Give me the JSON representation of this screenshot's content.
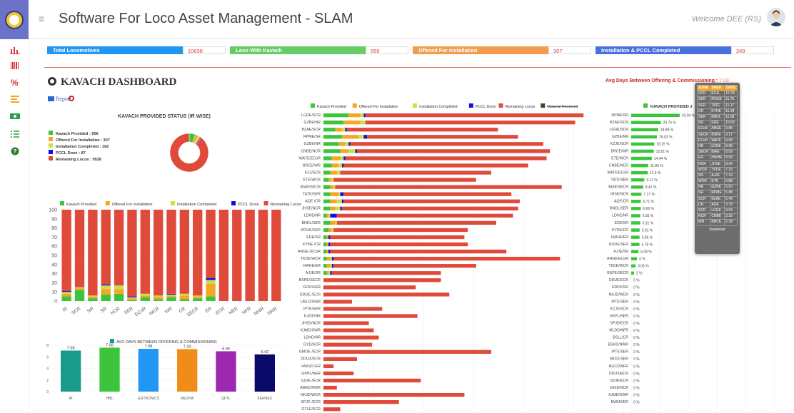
{
  "header": {
    "title": "Software For Loco Asset Management - SLAM",
    "welcome": "Welcome DEE (RS)"
  },
  "sidebar": {
    "icons": [
      "bar-chart-icon",
      "barcode-icon",
      "percent-icon",
      "list-icon",
      "money-icon",
      "list-check-icon",
      "help-icon"
    ]
  },
  "kpis": [
    {
      "label": "Total Locomotives",
      "value": "10638",
      "color": "#2196f3"
    },
    {
      "label": "Loco With Kavach",
      "value": "556",
      "color": "#66cc66"
    },
    {
      "label": "Offered For Installation",
      "value": "307",
      "color": "#f39c4f"
    },
    {
      "label": "Installation & PCCL Completed",
      "value": "249",
      "color": "#4a6fe0"
    }
  ],
  "dashboard": {
    "title": "KAVACH DASHBOARD",
    "report_label": "Report",
    "avg_days_heading": "Avg Days Between Offering & Commissioning : ",
    "avg_days_value": "7.08"
  },
  "colors": {
    "provided": "#3cc43c",
    "offered": "#f5a623",
    "installed": "#c8e04a",
    "pccl": "#1010e0",
    "remaining": "#e04a3a",
    "material": "#444422"
  },
  "status_pie": {
    "title": "KAVACH PROVIDED STATUS (IR WISE)",
    "legend": [
      "Kavach Provided : 556",
      "Offered For Installation : 307",
      "Installation Completed : 162",
      "PCCL Done : 87",
      "Remaining Locos : 9526"
    ],
    "values": [
      556,
      307,
      162,
      87,
      9526
    ]
  },
  "stacked_legend": [
    "Kavach Provided",
    "Offered For Installation",
    "Installation Completed",
    "PCCL Done",
    "Remaining Locos"
  ],
  "stacked": {
    "categories": [
      "IR",
      "SCR",
      "NR",
      "SR",
      "NCR",
      "SER",
      "ECoR",
      "WCR",
      "WR",
      "CR",
      "SECR",
      "ER",
      "ECR",
      "NER",
      "NFR",
      "NWR",
      "SWR"
    ],
    "provided": [
      5,
      12,
      3,
      7,
      8,
      1,
      4,
      2,
      4,
      2,
      3,
      5,
      0,
      0,
      0,
      0,
      0
    ],
    "offered": [
      3,
      2,
      2,
      6,
      5,
      2,
      2,
      3,
      2,
      4,
      2,
      14,
      0,
      0,
      0,
      0,
      0
    ],
    "installed": [
      2,
      1,
      1,
      4,
      4,
      1,
      2,
      1,
      1,
      2,
      1,
      4,
      0,
      0,
      0,
      0,
      0
    ],
    "pccl": [
      1,
      0,
      0,
      1,
      0,
      1,
      0,
      0,
      1,
      0,
      0,
      2,
      0,
      0,
      0,
      0,
      0
    ],
    "yticks": [
      "0",
      "10",
      "20",
      "30",
      "40",
      "50",
      "60",
      "70",
      "80",
      "90",
      "100"
    ]
  },
  "avg_bar": {
    "title": "AVG DAYS BETWEEN OFFERING & COMMISSIONING",
    "categories": [
      "IR",
      "HBL",
      "GGTRONICS",
      "MEDHA",
      "QFTL",
      "KERNEX"
    ],
    "values": [
      7.08,
      7.58,
      7.38,
      7.33,
      6.96,
      6.42
    ],
    "labels": [
      "7.08",
      "7.58",
      "7.38",
      "7.33",
      "6.96",
      "6.42"
    ],
    "colors": [
      "#1a9a8a",
      "#3cc43c",
      "#2196f3",
      "#f08c1a",
      "#9c27b0",
      "#0a0a6a"
    ],
    "yticks": [
      "0",
      "2",
      "4",
      "6",
      "8"
    ]
  },
  "shed_legend": [
    "Kavach Provided",
    "Offered For Installation",
    "Installation Completed",
    "PCCL Done",
    "Remaining Locos",
    "Material Received"
  ],
  "shed_chart": {
    "sheds": [
      "LGDE/SCR",
      "GZBE/NR",
      "BZAE/SCR",
      "RPME/SR",
      "GZBE/NR",
      "CNBE/NCR",
      "WATE/ECoR",
      "BRCE/WR",
      "KZJ/SCR",
      "ETE/WCR",
      "BIAE/SECR",
      "TATE/SER",
      "AQE /CR",
      "JHSE/NCR",
      "LDHE/NR",
      "BNDL/SER",
      "ROUE/SER",
      "EDE/SR",
      "KYNE /CR",
      "ANGE /ECoR",
      "TKDE/WCR",
      "HWHE/ER",
      "AJJE/SR",
      "BSPE/SECR",
      "GOOX/ER",
      "DDUE /ECR",
      "UBLD/SWR",
      "IPTE/SER",
      "KJGE/NR",
      "JHSD/NCR",
      "KJMD/SWR",
      "LDHD/NR",
      "GYD/SCR",
      "GMOE /ECR",
      "DDUX/ECR",
      "HWHD /ER",
      "GKPL/NER",
      "SJUE /ECR",
      "ABRD/NWR",
      "NKJD/WCR",
      "SPJD /ECR",
      "GTLE/SCR"
    ],
    "provided": [
      15,
      12,
      7,
      11,
      9,
      10,
      5,
      5,
      4,
      3,
      4,
      4,
      4,
      4,
      2,
      4,
      3,
      2,
      2,
      2,
      2,
      2,
      2,
      0,
      0,
      0,
      0,
      0,
      0,
      0,
      0,
      0,
      0,
      0,
      0,
      0,
      0,
      0,
      0,
      0,
      0,
      0
    ],
    "offered": [
      7,
      10,
      4,
      10,
      4,
      5,
      5,
      4,
      4,
      2,
      2,
      5,
      4,
      3,
      1,
      3,
      2,
      1,
      1,
      1,
      2,
      2,
      1,
      0,
      0,
      0,
      0,
      0,
      0,
      0,
      0,
      0,
      0,
      0,
      0,
      0,
      0,
      0,
      0,
      0,
      0,
      0
    ],
    "installed": [
      2,
      3,
      2,
      3,
      2,
      4,
      2,
      2,
      2,
      1,
      1,
      1,
      3,
      3,
      1,
      1,
      1,
      0,
      0,
      0,
      1,
      1,
      1,
      0,
      0,
      0,
      0,
      0,
      0,
      0,
      0,
      0,
      0,
      0,
      0,
      0,
      0,
      0,
      0,
      0,
      0,
      0
    ],
    "pccl": [
      1,
      0,
      1,
      2,
      1,
      1,
      1,
      1,
      0,
      0,
      0,
      2,
      1,
      1,
      4,
      0,
      0,
      1,
      1,
      1,
      1,
      1,
      1,
      0,
      0,
      0,
      0,
      0,
      0,
      0,
      0,
      0,
      0,
      0,
      0,
      0,
      0,
      0,
      0,
      0,
      0,
      0
    ],
    "remaining": [
      130,
      125,
      90,
      90,
      115,
      115,
      120,
      110,
      90,
      85,
      135,
      100,
      105,
      105,
      105,
      95,
      80,
      80,
      82,
      105,
      135,
      85,
      65,
      70,
      55,
      75,
      17,
      35,
      56,
      27,
      30,
      33,
      29,
      100,
      20,
      6,
      18,
      58,
      8,
      84,
      45,
      10
    ]
  },
  "pct_chart": {
    "title": "KAVACH PROVIDED 3",
    "sheds": [
      "RPME/SR",
      "BZAE/SCR",
      "LGDE/SCR",
      "GZBE/NR",
      "KZJE/SCR",
      "BRCE/WR",
      "ETE/WCR",
      "CNBE/NCR",
      "WATE/ECoR",
      "TATE/SER",
      "BIAE/SECR",
      "JHSE/NCR",
      "AQE/CR",
      "BNDL/SER",
      "LDHE/NR",
      "EDE/SR",
      "KYNE/CR",
      "HWHE/ER",
      "ROUE/SER",
      "AJJE/SR",
      "ANGE/ECoR",
      "TKDE/WCR",
      "BSPE/SECR",
      "DDUE/ECR",
      "EDDX/SR",
      "NKJD/WCR",
      "IPTE/SER",
      "KZJD/SCR",
      "GKPL/NER",
      "SPJD/ECR",
      "MLDD/NFR",
      "BSLL/CR",
      "BGKD/NWR",
      "IPTE/SER",
      "SRCE/SER",
      "NGCD/NFR",
      "DDUX/ECR",
      "SJUE/ECR",
      "JHSD/NCR",
      "KJMD/SWR",
      "BWNX/ER"
    ],
    "values": [
      33.94,
      20.75,
      18.88,
      18.03,
      16.15,
      15.81,
      14.44,
      11.86,
      11.6,
      9.17,
      8.42,
      7.17,
      6.71,
      6.69,
      6.35,
      6.31,
      5.91,
      5.85,
      5.78,
      5.08,
      4,
      3.06,
      2,
      0,
      0,
      0,
      0,
      0,
      0,
      0,
      0,
      0,
      0,
      0,
      0,
      0,
      0,
      0,
      0,
      0,
      0
    ],
    "labels": [
      "33.94 %",
      "20.75 %",
      "18.88 %",
      "18.03 %",
      "16.15 %",
      "15.81 %",
      "14.44 %",
      "11.86 %",
      "11.6 %",
      "9.17 %",
      "8.42 %",
      "7.17 %",
      "6.71 %",
      "6.69 %",
      "6.35 %",
      "6.31 %",
      "5.91 %",
      "5.85 %",
      "5.78 %",
      "5.08 %",
      "4 %",
      "3.06 %",
      "2 %",
      "0 %",
      "0 %",
      "0 %",
      "0 %",
      "0 %",
      "0 %",
      "0 %",
      "0 %",
      "0 %",
      "0 %",
      "0 %",
      "0 %",
      "0 %",
      "0 %",
      "0 %",
      "0 %",
      "0 %",
      "0 %"
    ]
  },
  "popup": {
    "headers": [
      "ZONE",
      "SHED",
      "DAYS"
    ],
    "rows": [
      [
        "SCR",
        "KZJL",
        "12.79"
      ],
      [
        "SER",
        "ROUE",
        "11.75"
      ],
      [
        "SER",
        "TATE",
        "11.17"
      ],
      [
        "CR",
        "KYNE",
        "11.08"
      ],
      [
        "SER",
        "BNDL",
        "11.08"
      ],
      [
        "SR",
        "EDE",
        "10.63"
      ],
      [
        "ECoR",
        "ANGE",
        "9.88"
      ],
      [
        "SECR",
        "BSPE",
        "9.17"
      ],
      [
        "ECoR",
        "WATE",
        "9.08"
      ],
      [
        "NR",
        "LDHE",
        "8.98"
      ],
      [
        "SECR",
        "BIAE",
        "8.09"
      ],
      [
        "ER",
        "HWHE",
        "8.08"
      ],
      [
        "NCR",
        "JHSE",
        "8.04"
      ],
      [
        "WCR",
        "TKDE",
        "7.33"
      ],
      [
        "SR",
        "AJJE",
        "7.13"
      ],
      [
        "WCR",
        "ETE",
        "6.88"
      ],
      [
        "NR",
        "GZBE",
        "6.50"
      ],
      [
        "SR",
        "RPME",
        "5.88"
      ],
      [
        "SCR",
        "BZAE",
        "5.46"
      ],
      [
        "CR",
        "AQE",
        "3.79"
      ],
      [
        "SCR",
        "LGDE",
        "3.54"
      ],
      [
        "NCR",
        "CNBE",
        "3.29"
      ],
      [
        "WR",
        "BRCE",
        "2.38"
      ]
    ],
    "download": "Download"
  }
}
